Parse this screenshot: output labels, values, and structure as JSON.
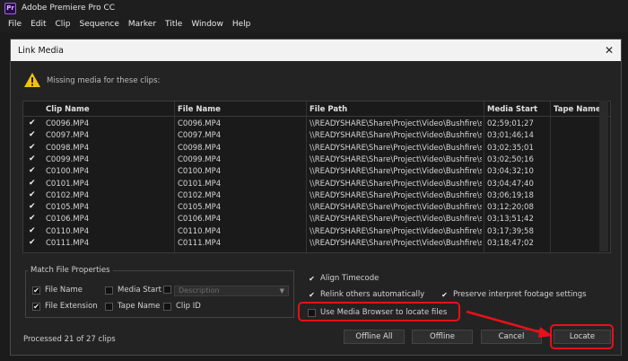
{
  "app": {
    "icon_text": "Pr",
    "title": "Adobe Premiere Pro CC"
  },
  "menu": [
    "File",
    "Edit",
    "Clip",
    "Sequence",
    "Marker",
    "Title",
    "Window",
    "Help"
  ],
  "dialog": {
    "title": "Link Media",
    "close_glyph": "✕",
    "warning_text": "Missing media for these clips:",
    "columns": [
      "Clip Name",
      "File Name",
      "File Path",
      "Media Start",
      "Tape Name"
    ],
    "rows": [
      {
        "checked": true,
        "clip": "C0096.MP4",
        "file": "C0096.MP4",
        "path": "\\\\READYSHARE\\Share\\Project\\Video\\Bushfire\\source",
        "start": "02;59;01;27",
        "tape": ""
      },
      {
        "checked": true,
        "clip": "C0097.MP4",
        "file": "C0097.MP4",
        "path": "\\\\READYSHARE\\Share\\Project\\Video\\Bushfire\\source",
        "start": "03;01;46;14",
        "tape": ""
      },
      {
        "checked": true,
        "clip": "C0098.MP4",
        "file": "C0098.MP4",
        "path": "\\\\READYSHARE\\Share\\Project\\Video\\Bushfire\\source",
        "start": "03;02;35;01",
        "tape": ""
      },
      {
        "checked": true,
        "clip": "C0099.MP4",
        "file": "C0099.MP4",
        "path": "\\\\READYSHARE\\Share\\Project\\Video\\Bushfire\\source",
        "start": "03;02;50;16",
        "tape": ""
      },
      {
        "checked": true,
        "clip": "C0100.MP4",
        "file": "C0100.MP4",
        "path": "\\\\READYSHARE\\Share\\Project\\Video\\Bushfire\\source",
        "start": "03;04;32;10",
        "tape": ""
      },
      {
        "checked": true,
        "clip": "C0101.MP4",
        "file": "C0101.MP4",
        "path": "\\\\READYSHARE\\Share\\Project\\Video\\Bushfire\\source",
        "start": "03;04;47;40",
        "tape": ""
      },
      {
        "checked": true,
        "clip": "C0102.MP4",
        "file": "C0102.MP4",
        "path": "\\\\READYSHARE\\Share\\Project\\Video\\Bushfire\\source",
        "start": "03;06;19;18",
        "tape": ""
      },
      {
        "checked": true,
        "clip": "C0105.MP4",
        "file": "C0105.MP4",
        "path": "\\\\READYSHARE\\Share\\Project\\Video\\Bushfire\\source",
        "start": "03;12;20;08",
        "tape": ""
      },
      {
        "checked": true,
        "clip": "C0106.MP4",
        "file": "C0106.MP4",
        "path": "\\\\READYSHARE\\Share\\Project\\Video\\Bushfire\\source",
        "start": "03;13;51;42",
        "tape": ""
      },
      {
        "checked": true,
        "clip": "C0110.MP4",
        "file": "C0110.MP4",
        "path": "\\\\READYSHARE\\Share\\Project\\Video\\Bushfire\\source",
        "start": "03;17;39;58",
        "tape": ""
      },
      {
        "checked": true,
        "clip": "C0111.MP4",
        "file": "C0111.MP4",
        "path": "\\\\READYSHARE\\Share\\Project\\Video\\Bushfire\\source",
        "start": "03;18;47;02",
        "tape": ""
      }
    ],
    "match_group_title": "Match File Properties",
    "match_options": [
      {
        "label": "File Name",
        "checked": true
      },
      {
        "label": "Media Start",
        "checked": false
      },
      {
        "label": "File Extension",
        "checked": true
      },
      {
        "label": "Tape Name",
        "checked": false
      },
      {
        "label": "Clip ID",
        "checked": false
      }
    ],
    "description_placeholder": "Description",
    "right_options": {
      "align_timecode": {
        "label": "Align Timecode",
        "checked": true
      },
      "relink_others": {
        "label": "Relink others automatically",
        "checked": true
      },
      "preserve_interpret": {
        "label": "Preserve interpret footage settings",
        "checked": true
      },
      "use_media_browser": {
        "label": "Use Media Browser to locate files",
        "checked": false
      }
    },
    "processed_text": "Processed 21 of 27 clips",
    "buttons": {
      "offline_all": "Offline All",
      "offline": "Offline",
      "cancel": "Cancel",
      "locate": "Locate"
    },
    "check_glyph": "✔",
    "colors": {
      "highlight": "#e8101a",
      "warning": "#f5c400"
    }
  }
}
